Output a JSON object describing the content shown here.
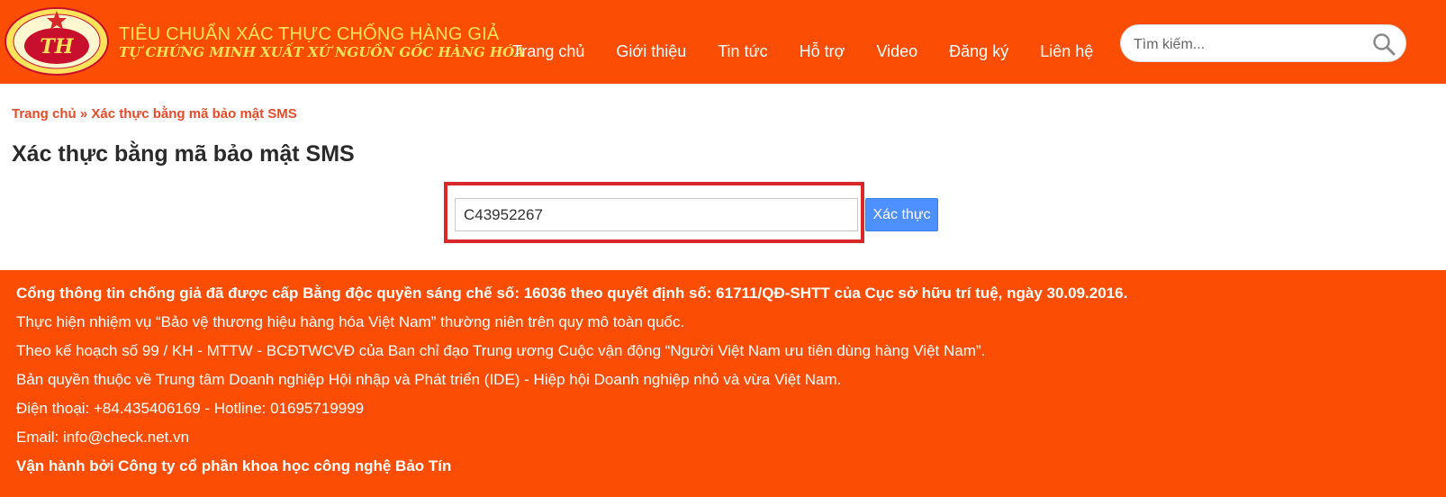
{
  "header": {
    "logo_letters": "TH",
    "logo_ring_text": "TIÊU CHUẨN XÁC THỰC CHỐNG HÀNG GIẢ · TỰ CHỨNG MINH XUẤT XỨ NGUỒN GỐC HÀNG HÓA",
    "title_line1": "TIÊU CHUẨN XÁC THỰC CHỐNG HÀNG GIẢ",
    "title_line2": "TỰ CHỨNG MINH XUẤT XỨ NGUỒN GỐC HÀNG HÓA",
    "nav": [
      {
        "label": "Trang chủ"
      },
      {
        "label": "Giới thiệu"
      },
      {
        "label": "Tin tức"
      },
      {
        "label": "Hỗ trợ"
      },
      {
        "label": "Video"
      },
      {
        "label": "Đăng ký"
      },
      {
        "label": "Liên hệ"
      }
    ],
    "search": {
      "placeholder": "Tìm kiếm...",
      "icon": "search-icon"
    }
  },
  "breadcrumb": {
    "home": "Trang chủ",
    "separator": "»",
    "current": "Xác thực bằng mã bảo mật SMS"
  },
  "page_title": "Xác thực bằng mã bảo mật SMS",
  "form": {
    "code_value": "C43952267",
    "submit_label": "Xác thực"
  },
  "footer": {
    "line1": "Cổng thông tin chống giả đã được cấp Bằng độc quyền sáng chế số: 16036 theo quyết định số: 61711/QĐ-SHTT của Cục sở hữu trí tuệ, ngày 30.09.2016.",
    "line2": "Thực hiện nhiệm vụ “Bảo vệ thương hiệu hàng hóa Việt Nam” thường niên trên quy mô toàn quốc.",
    "line3": "Theo kế hoạch số 99 / KH - MTTW - BCĐTWCVĐ của Ban chỉ đạo Trung ương Cuộc vận động “Người Việt Nam ưu tiên dùng hàng Việt Nam”.",
    "line4": "Bản quyền thuộc về Trung tâm Doanh nghiệp Hội nhập và Phát triển (IDE) - Hiệp hội Doanh nghiệp nhỏ và vừa Việt Nam.",
    "line5": "Điện thoại: +84.435406169 - Hotline: 01695719999",
    "line6": "Email: info@check.net.vn",
    "line7": "Vận hành bởi Công ty cổ phần khoa học công nghệ Bảo Tín"
  },
  "colors": {
    "brand_orange": "#fb4e04",
    "logo_yellow": "#ffe35a",
    "breadcrumb_red": "#e34b2a",
    "highlight_red": "#d8282a",
    "button_blue": "#4d90fe"
  }
}
